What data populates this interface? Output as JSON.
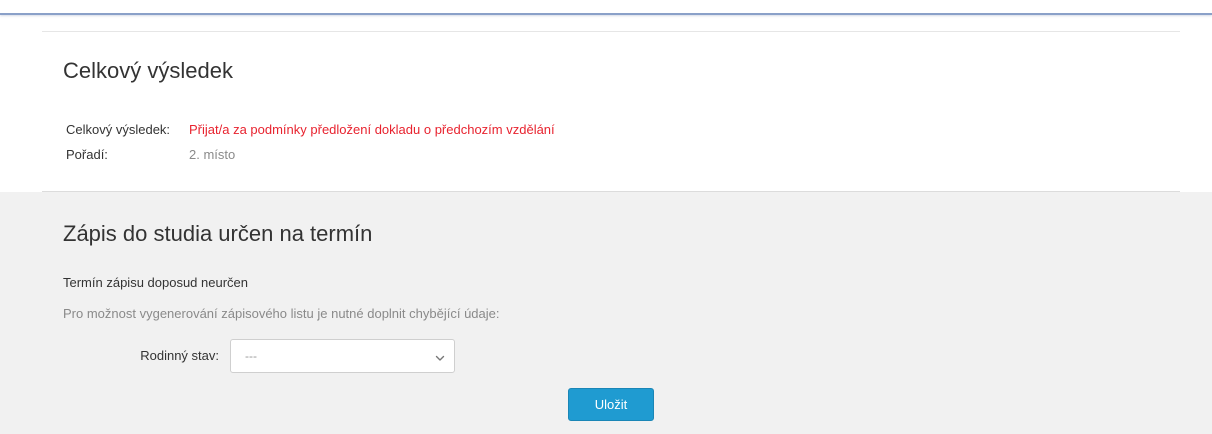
{
  "result": {
    "title": "Celkový výsledek",
    "rows": [
      {
        "label": "Celkový výsledek:",
        "value": "Přijat/a za podmínky předložení dokladu o předchozím vzdělání",
        "color": "#e8232f"
      },
      {
        "label": "Pořadí:",
        "value": "2. místo",
        "color": "#8a8a8a"
      }
    ]
  },
  "enrollment": {
    "title": "Zápis do studia určen na termín",
    "term_status": "Termín zápisu doposud neurčen",
    "note": "Pro možnost vygenerování zápisového listu je nutné doplnit chybějící údaje:",
    "marital_status": {
      "label": "Rodinný stav:",
      "selected": "---",
      "icon": "chevron-down-icon"
    },
    "save_label": "Uložit"
  },
  "colors": {
    "accent": "#1f9bd1",
    "alert": "#e8232f",
    "section_background": "#f1f1f1"
  }
}
